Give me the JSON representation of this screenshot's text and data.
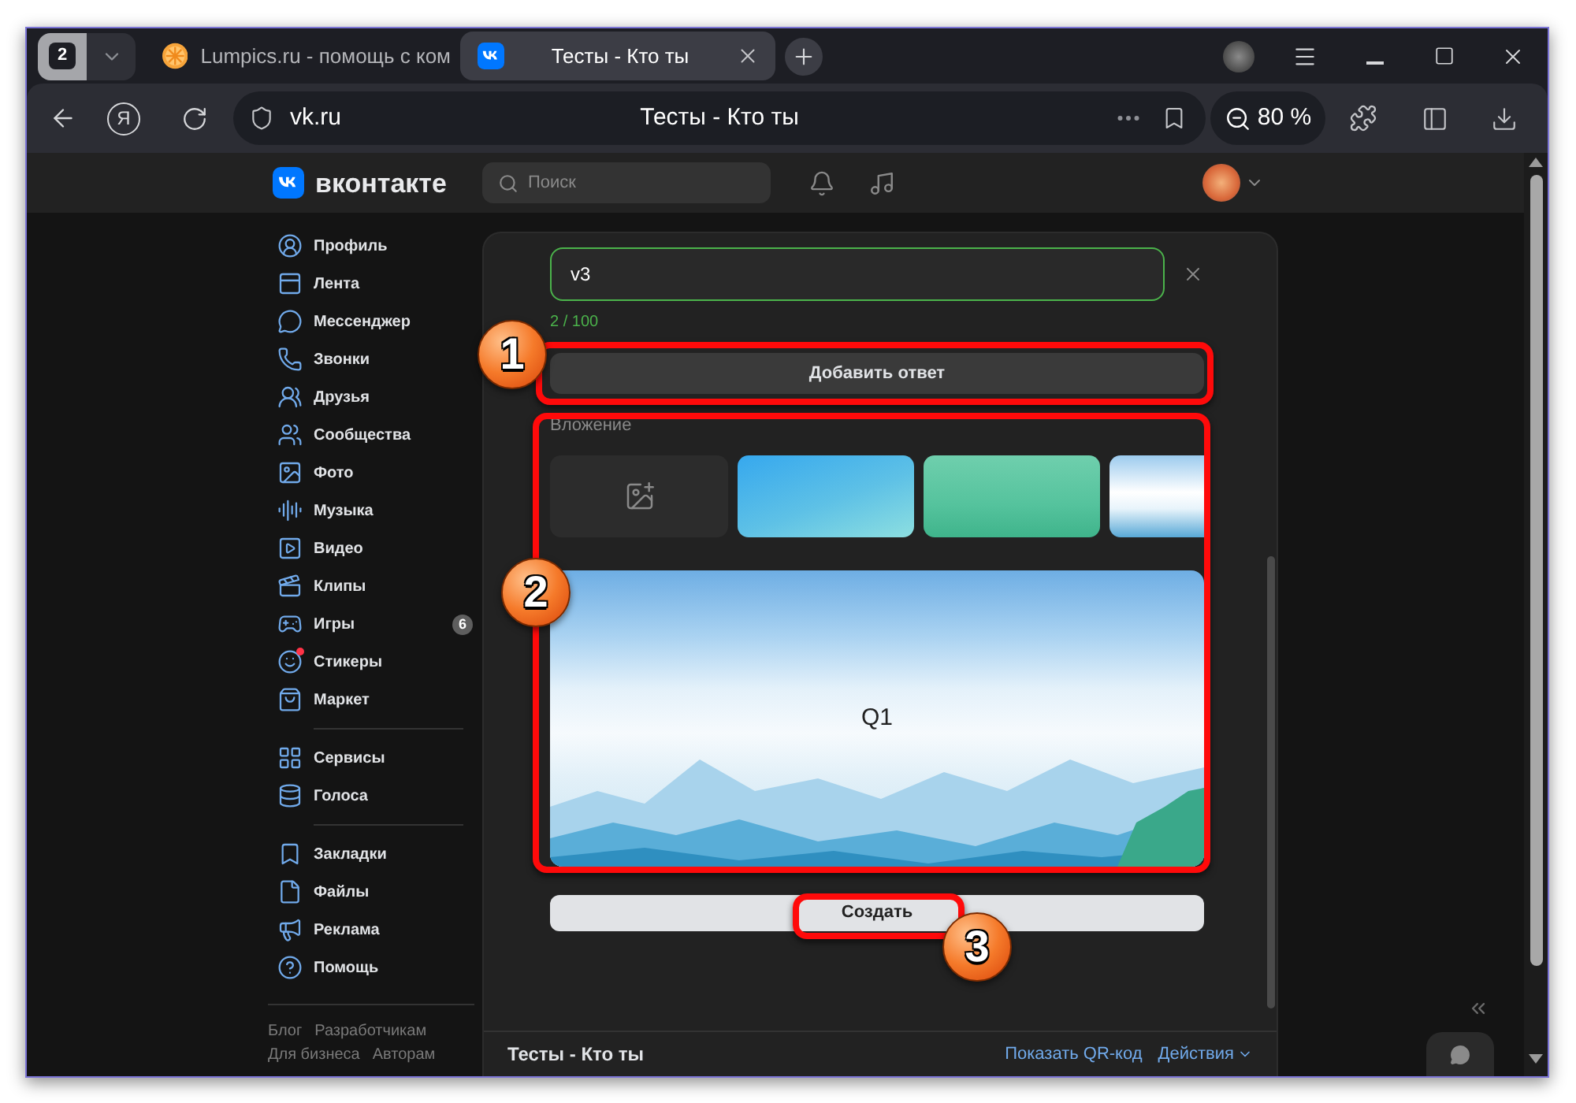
{
  "browser": {
    "tab_counter": "2",
    "tabs": [
      {
        "title": "Lumpics.ru - помощь с ком",
        "kind": "site",
        "selected": false
      },
      {
        "title": "Тесты - Кто ты",
        "kind": "vk",
        "selected": true
      }
    ],
    "yandex_button": "Я",
    "address": {
      "url": "vk.ru",
      "page_title": "Тесты - Кто ты"
    },
    "zoom": "80 %"
  },
  "header": {
    "logo": "вконтакте",
    "search": {
      "placeholder": "Поиск"
    }
  },
  "sidebar": {
    "groups": [
      {
        "items": [
          {
            "label": "Профиль",
            "unread": false
          },
          {
            "label": "Лента",
            "unread": false
          },
          {
            "label": "Мессенджер",
            "unread": false
          },
          {
            "label": "Звонки",
            "unread": false
          },
          {
            "label": "Друзья",
            "unread": false
          },
          {
            "label": "Сообщества",
            "unread": false
          },
          {
            "label": "Фото",
            "unread": false
          },
          {
            "label": "Музыка",
            "unread": false
          },
          {
            "label": "Видео",
            "unread": false
          },
          {
            "label": "Клипы",
            "unread": false
          },
          {
            "label": "Игры",
            "badge": "6",
            "unread": false
          },
          {
            "label": "Стикеры",
            "unread": true
          },
          {
            "label": "Маркет",
            "unread": false
          }
        ]
      },
      {
        "items": [
          {
            "label": "Сервисы",
            "unread": false
          },
          {
            "label": "Голоса",
            "unread": false
          }
        ]
      },
      {
        "items": [
          {
            "label": "Закладки",
            "unread": false
          },
          {
            "label": "Файлы",
            "unread": false
          },
          {
            "label": "Реклама",
            "unread": false
          },
          {
            "label": "Помощь",
            "unread": false
          }
        ]
      }
    ],
    "footer_links": [
      "Блог",
      "Разработчикам",
      "Для бизнеса",
      "Авторам"
    ]
  },
  "poll_editor": {
    "answer_field": {
      "value": "v3",
      "counter": "2 / 100"
    },
    "add_answer_button": "Добавить ответ",
    "attachment_label": "Вложение",
    "backgrounds": [
      {
        "kind": "upload"
      },
      {
        "kind": "sky"
      },
      {
        "kind": "sea"
      },
      {
        "kind": "watercolor"
      }
    ],
    "preview": {
      "question": "Q1"
    },
    "create_button": "Создать"
  },
  "footer": {
    "title": "Тесты - Кто ты",
    "links": [
      {
        "label": "Показать QR-код",
        "kind": "link"
      },
      {
        "label": "Действия",
        "kind": "menu"
      }
    ]
  },
  "annotations": [
    {
      "number": "1"
    },
    {
      "number": "2"
    },
    {
      "number": "3"
    }
  ]
}
